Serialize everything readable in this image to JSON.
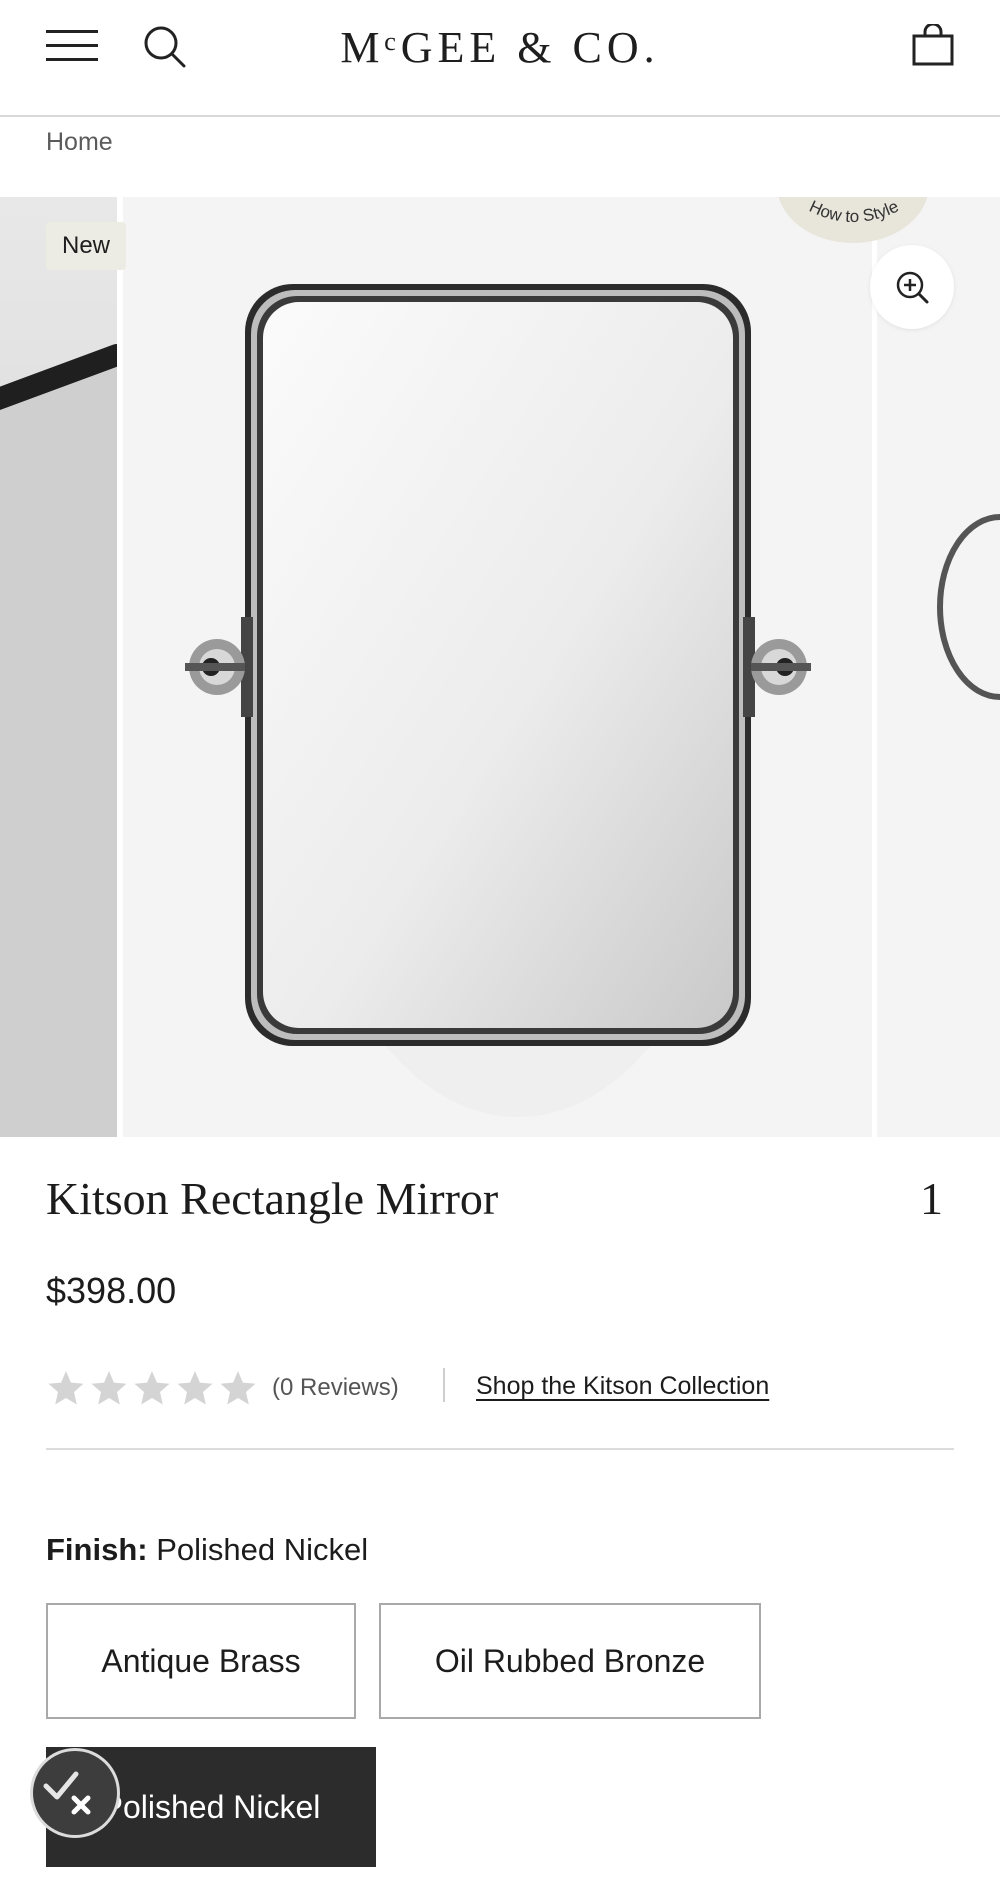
{
  "header": {
    "logo": "MᶜGEE & CO.",
    "menu_icon": "hamburger-icon",
    "search_icon": "search-icon",
    "cart_icon": "shopping-bag-icon"
  },
  "breadcrumb": {
    "home": "Home"
  },
  "gallery": {
    "badge": "New",
    "how_to_style": "How to Style",
    "zoom_icon": "zoom-in-icon"
  },
  "product": {
    "title": "Kitson Rectangle Mirror",
    "slide_counter": "1",
    "price": "$398.00",
    "rating": {
      "stars": 0,
      "max": 5,
      "reviews_text": "(0 Reviews)"
    },
    "collection_link": "Shop the Kitson Collection"
  },
  "finish": {
    "label": "Finish:",
    "selected": "Polished Nickel",
    "options": [
      "Antique Brass",
      "Oil Rubbed Bronze",
      "Polished Nickel"
    ]
  },
  "colors": {
    "selected_bg": "#2c2c2c",
    "badge_bg": "#ecebe4",
    "star_color": "#d4d4d4"
  }
}
